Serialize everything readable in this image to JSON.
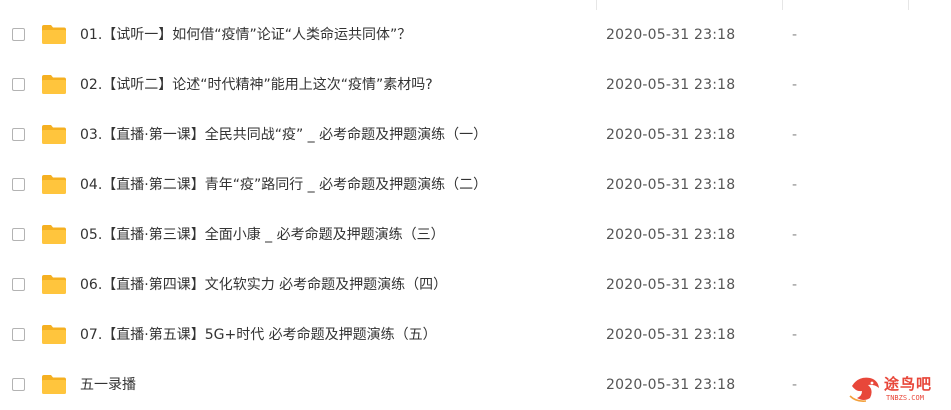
{
  "files": [
    {
      "name": "01.【试听一】如何借“疫情”论证“人类命运共同体”？",
      "modified": "2020-05-31 23:18",
      "size": "-"
    },
    {
      "name": "02.【试听二】论述“时代精神”能用上这次“疫情”素材吗?",
      "modified": "2020-05-31 23:18",
      "size": "-"
    },
    {
      "name": "03.【直播·第一课】全民共同战“疫” _ 必考命题及押题演练（一）",
      "modified": "2020-05-31 23:18",
      "size": "-"
    },
    {
      "name": "04.【直播·第二课】青年“疫”路同行 _ 必考命题及押题演练（二）",
      "modified": "2020-05-31 23:18",
      "size": "-"
    },
    {
      "name": "05.【直播·第三课】全面小康 _ 必考命题及押题演练（三）",
      "modified": "2020-05-31 23:18",
      "size": "-"
    },
    {
      "name": "06.【直播·第四课】文化软实力  必考命题及押题演练（四）",
      "modified": "2020-05-31 23:18",
      "size": "-"
    },
    {
      "name": "07.【直播·第五课】5G+时代  必考命题及押题演练（五）",
      "modified": "2020-05-31 23:18",
      "size": "-"
    },
    {
      "name": "五一录播",
      "modified": "2020-05-31 23:18",
      "size": "-"
    }
  ],
  "watermark": {
    "text": "途鸟吧",
    "url": "TNBZS.COM"
  },
  "colors": {
    "folder": "#FFC53D",
    "folder_back": "#F5B021",
    "watermark": "#E8473A"
  },
  "icons": {
    "row_icon": "folder-icon",
    "watermark_logo": "bird-logo-icon"
  }
}
